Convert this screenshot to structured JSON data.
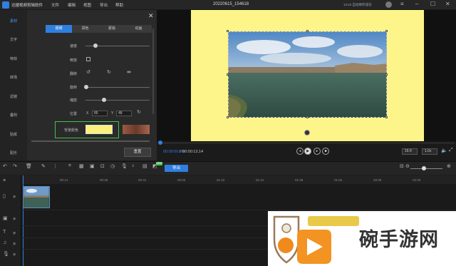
{
  "app": {
    "name": "迅捷视频剪辑软件",
    "menus": [
      "文件",
      "编辑",
      "视图",
      "导出",
      "帮助"
    ],
    "document_title": "20220615_154618",
    "status": "13:44 自动保存成功"
  },
  "sidebar": {
    "items": [
      {
        "label": "素材",
        "active": true
      },
      {
        "label": "文字"
      },
      {
        "label": "特效"
      },
      {
        "label": "转场"
      },
      {
        "label": "滤镜"
      },
      {
        "label": "叠附"
      },
      {
        "label": "贴纸"
      },
      {
        "label": "配乐"
      }
    ]
  },
  "panel": {
    "tabs": [
      {
        "label": "视频",
        "active": true
      },
      {
        "label": "调色"
      },
      {
        "label": "蒙版"
      },
      {
        "label": "动画"
      }
    ],
    "speed_label": "速度",
    "reverse_label": "倒放",
    "flip_label": "翻转",
    "rotate_label": "旋转",
    "scale_label": "缩放",
    "position_label": "位置",
    "x_label": "X",
    "x_value": "85",
    "y_label": "Y",
    "y_value": "48",
    "bg_color_label": "背景颜色",
    "reset_label": "重置"
  },
  "colors": {
    "canvas_background": "#fdf58a",
    "accent": "#2f7fe0",
    "highlight": "#3fc24b"
  },
  "playback": {
    "current_time": "00:00:00.00",
    "separator": "/",
    "total_time": "00:00:13.14",
    "aspect": "16:9",
    "speed": "1.0x"
  },
  "toolbar": {
    "new_badge": "NEW",
    "export_label": "导出"
  },
  "ruler": {
    "ticks": [
      "00:00",
      "00:14",
      "00:28",
      "00:42",
      "00:56",
      "01:10",
      "01:24",
      "01:38",
      "01:52",
      "02:06",
      "02:20"
    ]
  },
  "watermark": {
    "text": "碗手游网"
  }
}
